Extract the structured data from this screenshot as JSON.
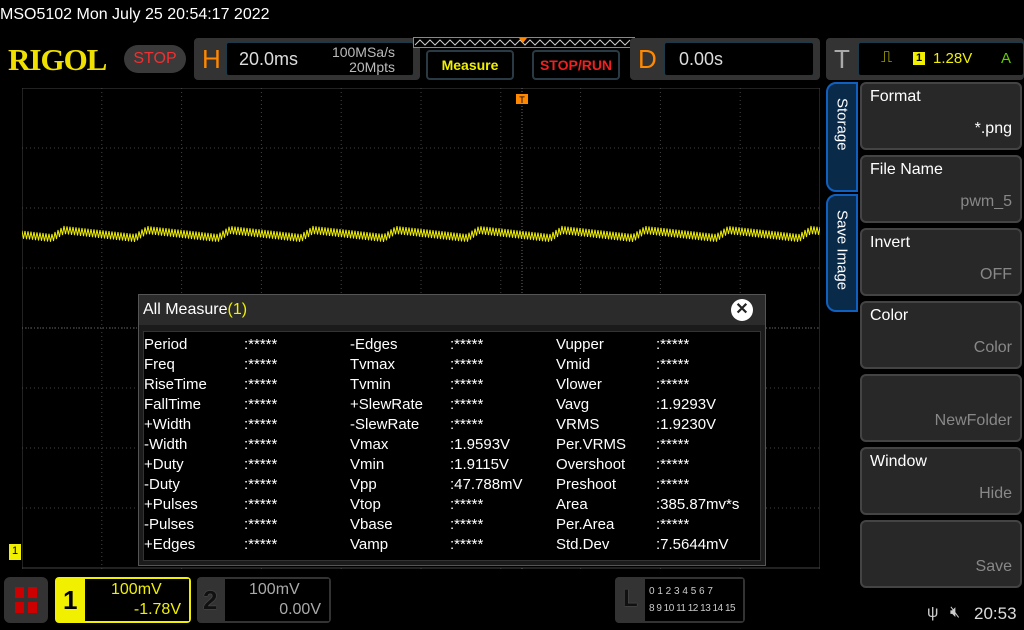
{
  "header": {
    "title": "MSO5102  Mon July 25 20:54:17 2022",
    "logo": "RIGOL",
    "run_state": "STOP",
    "horizontal": {
      "letter": "H",
      "timebase": "20.0ms",
      "sample_rate": "100MSa/s",
      "memory_depth": "20Mpts"
    },
    "measure_label": "Measure",
    "stoprun_label": "STOP/RUN",
    "delay": {
      "letter": "D",
      "value": "0.00s"
    },
    "trigger": {
      "letter": "T",
      "source": "1",
      "level": "1.28V",
      "mode": "A",
      "icon": "rising-edge-icon"
    }
  },
  "colors": {
    "ch1": "#f0f000",
    "accent": "#ff8800",
    "stop": "#f03030",
    "panel_border": "#1060c0"
  },
  "measure": {
    "title": "All Measure",
    "count": "(1)",
    "close": "✕",
    "columns": [
      [
        [
          "Period",
          ":*****"
        ],
        [
          "Freq",
          ":*****"
        ],
        [
          "RiseTime",
          ":*****"
        ],
        [
          "FallTime",
          ":*****"
        ],
        [
          "+Width",
          ":*****"
        ],
        [
          "-Width",
          ":*****"
        ],
        [
          "+Duty",
          ":*****"
        ],
        [
          "-Duty",
          ":*****"
        ],
        [
          "+Pulses",
          ":*****"
        ],
        [
          "-Pulses",
          ":*****"
        ],
        [
          "+Edges",
          ":*****"
        ]
      ],
      [
        [
          "-Edges",
          ":*****"
        ],
        [
          "Tvmax",
          ":*****"
        ],
        [
          "Tvmin",
          ":*****"
        ],
        [
          "+SlewRate",
          ":*****"
        ],
        [
          "-SlewRate",
          ":*****"
        ],
        [
          "Vmax",
          ":1.9593V"
        ],
        [
          "Vmin",
          ":1.9115V"
        ],
        [
          "Vpp",
          ":47.788mV"
        ],
        [
          "Vtop",
          ":*****"
        ],
        [
          "Vbase",
          ":*****"
        ],
        [
          "Vamp",
          ":*****"
        ]
      ],
      [
        [
          "Vupper",
          ":*****"
        ],
        [
          "Vmid",
          ":*****"
        ],
        [
          "Vlower",
          ":*****"
        ],
        [
          "Vavg",
          ":1.9293V"
        ],
        [
          "VRMS",
          ":1.9230V"
        ],
        [
          "Per.VRMS",
          ":*****"
        ],
        [
          "Overshoot",
          ":*****"
        ],
        [
          "Preshoot",
          ":*****"
        ],
        [
          "Area",
          ":385.87mv*s"
        ],
        [
          "Per.Area",
          ":*****"
        ],
        [
          "Std.Dev",
          ":7.5644mV"
        ]
      ]
    ]
  },
  "side": {
    "tabs": [
      "Storage",
      "Save Image"
    ],
    "buttons": [
      {
        "label": "Format",
        "value": "*.png"
      },
      {
        "label": "File Name",
        "value": "pwm_5"
      },
      {
        "label": "Invert",
        "value": "OFF"
      },
      {
        "label": "Color",
        "value": "Color"
      },
      {
        "label": "",
        "value": "NewFolder"
      },
      {
        "label": "Window",
        "value": "Hide"
      },
      {
        "label": "",
        "value": "Save"
      }
    ]
  },
  "channels": [
    {
      "num": "1",
      "scale": "100mV",
      "offset": "-1.78V"
    },
    {
      "num": "2",
      "scale": "100mV",
      "offset": "0.00V"
    }
  ],
  "la": {
    "letter": "L",
    "row1": "0 1 2 3  4 5 6 7",
    "row2": "8 9 10 11 12 13 14 15"
  },
  "status": {
    "time": "20:53",
    "ch1_marker": "1"
  }
}
